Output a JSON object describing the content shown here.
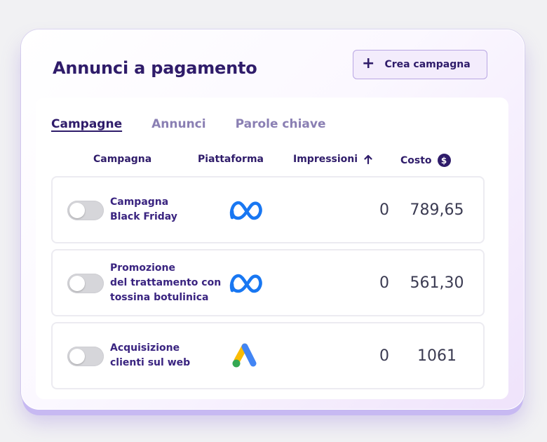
{
  "page": {
    "title": "Annunci a pagamento"
  },
  "toolbar": {
    "create_label": "Crea campagna",
    "create_icon": "plus-icon"
  },
  "tabs": [
    {
      "label": "Campagne",
      "active": true
    },
    {
      "label": "Annunci",
      "active": false
    },
    {
      "label": "Parole chiave",
      "active": false
    }
  ],
  "table": {
    "columns": {
      "campaign": "Campagna",
      "platform": "Piattaforma",
      "impressions": "Impressioni",
      "cost": "Costo"
    },
    "sort_icon": "arrow-up-icon",
    "currency_icon": "dollar-icon",
    "rows": [
      {
        "name": "Campagna\nBlack Friday",
        "platform": "meta",
        "enabled": false,
        "impressions": "0",
        "cost": "789,65"
      },
      {
        "name": "Promozione\ndel trattamento con\ntossina botulinica",
        "platform": "meta",
        "enabled": false,
        "impressions": "0",
        "cost": "561,30"
      },
      {
        "name": "Acquisizione\nclienti sul web",
        "platform": "google-ads",
        "enabled": false,
        "impressions": "0",
        "cost": "1061"
      }
    ]
  },
  "colors": {
    "primary": "#2f1c6a",
    "muted_tab": "#8a7fb3",
    "meta_blue": "#1877f2",
    "google_blue": "#4285f4",
    "google_yellow": "#fbbc04",
    "google_green": "#34a853"
  }
}
